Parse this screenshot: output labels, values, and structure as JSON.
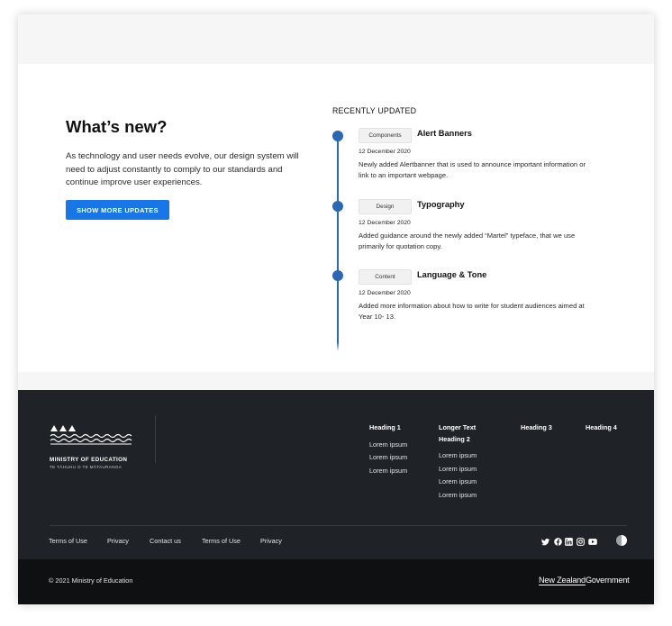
{
  "whats_new": {
    "title": "What’s new?",
    "description": "As technology and user needs evolve, our design system will need to adjust constantly to comply to our standards and continue improve user experiences.",
    "button_label": "SHOW MORE UPDATES"
  },
  "recently_updated": {
    "heading": "RECENTLY UPDATED",
    "items": [
      {
        "tag": "Components",
        "title": "Alert Banners",
        "date": "12 December 2020",
        "description": "Newly added Alertbanner that is used to announce important information or link to an important webpage."
      },
      {
        "tag": "Design",
        "title": "Typography",
        "date": "12 December 2020",
        "description": "Added guidance around the newly added “Martel” typeface, that we use primarily for quotation copy."
      },
      {
        "tag": "Content",
        "title": "Language & Tone",
        "date": "12 December 2020",
        "description": "Added more information about how to write for student audiences aimed at Year 10- 13."
      }
    ]
  },
  "footer": {
    "logo": {
      "name": "MINISTRY OF EDUCATION",
      "subtitle": "TE TĀHUHU O TE MĀTAURANGA"
    },
    "columns": [
      {
        "heading": "Heading 1",
        "links": [
          "Lorem ipsum",
          "Lorem ipsum",
          "Lorem ipsum"
        ]
      },
      {
        "heading": "Longer Text Heading 2",
        "links": [
          "Lorem ipsum",
          "Lorem ipsum",
          "Lorem ipsum",
          "Lorem ipsum"
        ]
      },
      {
        "heading": "Heading 3",
        "links": []
      },
      {
        "heading": "Heading 4",
        "links": []
      }
    ],
    "legal_links": [
      "Terms of Use",
      "Privacy",
      "Contact us",
      "Terms of Use",
      "Privacy"
    ],
    "social_icons": [
      "twitter-icon",
      "facebook-icon",
      "linkedin-icon",
      "instagram-icon",
      "youtube-icon"
    ],
    "copyright": "© 2021 Ministry of Education",
    "government_logo": {
      "part1": "New Zealand",
      "part2": "Government"
    }
  },
  "colors": {
    "accent": "#1877e8",
    "timeline": "#2a67b4",
    "footer_bg": "#1f2327",
    "footer_bottom_bg": "#0f1011"
  }
}
